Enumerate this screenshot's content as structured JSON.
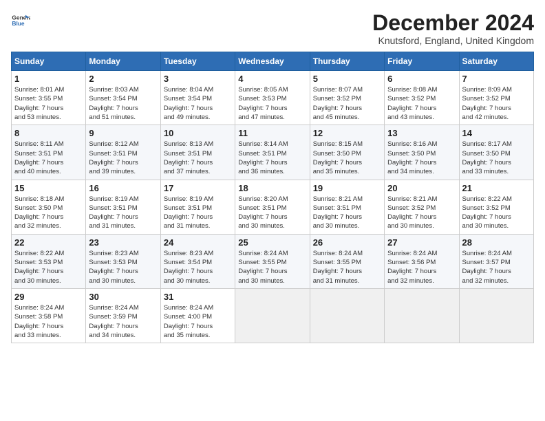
{
  "header": {
    "logo_line1": "General",
    "logo_line2": "Blue",
    "title": "December 2024",
    "subtitle": "Knutsford, England, United Kingdom"
  },
  "calendar": {
    "days_of_week": [
      "Sunday",
      "Monday",
      "Tuesday",
      "Wednesday",
      "Thursday",
      "Friday",
      "Saturday"
    ],
    "weeks": [
      [
        {
          "day": "",
          "info": ""
        },
        {
          "day": "2",
          "info": "Sunrise: 8:03 AM\nSunset: 3:54 PM\nDaylight: 7 hours\nand 51 minutes."
        },
        {
          "day": "3",
          "info": "Sunrise: 8:04 AM\nSunset: 3:54 PM\nDaylight: 7 hours\nand 49 minutes."
        },
        {
          "day": "4",
          "info": "Sunrise: 8:05 AM\nSunset: 3:53 PM\nDaylight: 7 hours\nand 47 minutes."
        },
        {
          "day": "5",
          "info": "Sunrise: 8:07 AM\nSunset: 3:52 PM\nDaylight: 7 hours\nand 45 minutes."
        },
        {
          "day": "6",
          "info": "Sunrise: 8:08 AM\nSunset: 3:52 PM\nDaylight: 7 hours\nand 43 minutes."
        },
        {
          "day": "7",
          "info": "Sunrise: 8:09 AM\nSunset: 3:52 PM\nDaylight: 7 hours\nand 42 minutes."
        }
      ],
      [
        {
          "day": "1",
          "info": "Sunrise: 8:01 AM\nSunset: 3:55 PM\nDaylight: 7 hours\nand 53 minutes."
        },
        {
          "day": "9",
          "info": "Sunrise: 8:12 AM\nSunset: 3:51 PM\nDaylight: 7 hours\nand 39 minutes."
        },
        {
          "day": "10",
          "info": "Sunrise: 8:13 AM\nSunset: 3:51 PM\nDaylight: 7 hours\nand 37 minutes."
        },
        {
          "day": "11",
          "info": "Sunrise: 8:14 AM\nSunset: 3:51 PM\nDaylight: 7 hours\nand 36 minutes."
        },
        {
          "day": "12",
          "info": "Sunrise: 8:15 AM\nSunset: 3:50 PM\nDaylight: 7 hours\nand 35 minutes."
        },
        {
          "day": "13",
          "info": "Sunrise: 8:16 AM\nSunset: 3:50 PM\nDaylight: 7 hours\nand 34 minutes."
        },
        {
          "day": "14",
          "info": "Sunrise: 8:17 AM\nSunset: 3:50 PM\nDaylight: 7 hours\nand 33 minutes."
        }
      ],
      [
        {
          "day": "8",
          "info": "Sunrise: 8:11 AM\nSunset: 3:51 PM\nDaylight: 7 hours\nand 40 minutes."
        },
        {
          "day": "16",
          "info": "Sunrise: 8:19 AM\nSunset: 3:51 PM\nDaylight: 7 hours\nand 31 minutes."
        },
        {
          "day": "17",
          "info": "Sunrise: 8:19 AM\nSunset: 3:51 PM\nDaylight: 7 hours\nand 31 minutes."
        },
        {
          "day": "18",
          "info": "Sunrise: 8:20 AM\nSunset: 3:51 PM\nDaylight: 7 hours\nand 30 minutes."
        },
        {
          "day": "19",
          "info": "Sunrise: 8:21 AM\nSunset: 3:51 PM\nDaylight: 7 hours\nand 30 minutes."
        },
        {
          "day": "20",
          "info": "Sunrise: 8:21 AM\nSunset: 3:52 PM\nDaylight: 7 hours\nand 30 minutes."
        },
        {
          "day": "21",
          "info": "Sunrise: 8:22 AM\nSunset: 3:52 PM\nDaylight: 7 hours\nand 30 minutes."
        }
      ],
      [
        {
          "day": "15",
          "info": "Sunrise: 8:18 AM\nSunset: 3:50 PM\nDaylight: 7 hours\nand 32 minutes."
        },
        {
          "day": "23",
          "info": "Sunrise: 8:23 AM\nSunset: 3:53 PM\nDaylight: 7 hours\nand 30 minutes."
        },
        {
          "day": "24",
          "info": "Sunrise: 8:23 AM\nSunset: 3:54 PM\nDaylight: 7 hours\nand 30 minutes."
        },
        {
          "day": "25",
          "info": "Sunrise: 8:24 AM\nSunset: 3:55 PM\nDaylight: 7 hours\nand 30 minutes."
        },
        {
          "day": "26",
          "info": "Sunrise: 8:24 AM\nSunset: 3:55 PM\nDaylight: 7 hours\nand 31 minutes."
        },
        {
          "day": "27",
          "info": "Sunrise: 8:24 AM\nSunset: 3:56 PM\nDaylight: 7 hours\nand 32 minutes."
        },
        {
          "day": "28",
          "info": "Sunrise: 8:24 AM\nSunset: 3:57 PM\nDaylight: 7 hours\nand 32 minutes."
        }
      ],
      [
        {
          "day": "22",
          "info": "Sunrise: 8:22 AM\nSunset: 3:53 PM\nDaylight: 7 hours\nand 30 minutes."
        },
        {
          "day": "30",
          "info": "Sunrise: 8:24 AM\nSunset: 3:59 PM\nDaylight: 7 hours\nand 34 minutes."
        },
        {
          "day": "31",
          "info": "Sunrise: 8:24 AM\nSunset: 4:00 PM\nDaylight: 7 hours\nand 35 minutes."
        },
        {
          "day": "",
          "info": ""
        },
        {
          "day": "",
          "info": ""
        },
        {
          "day": "",
          "info": ""
        },
        {
          "day": "",
          "info": ""
        }
      ]
    ],
    "week5_col0": {
      "day": "29",
      "info": "Sunrise: 8:24 AM\nSunset: 3:58 PM\nDaylight: 7 hours\nand 33 minutes."
    }
  }
}
